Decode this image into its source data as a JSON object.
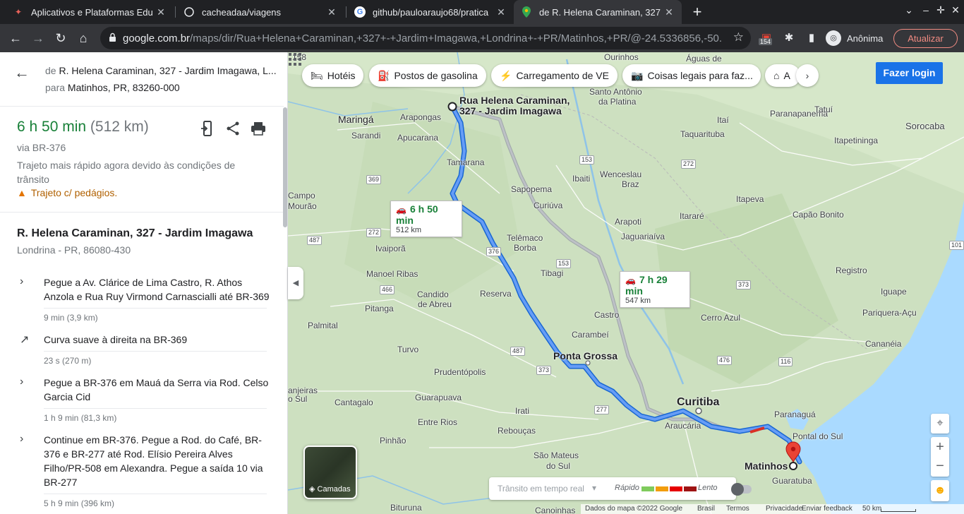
{
  "browser": {
    "tabs": [
      {
        "title": "Aplicativos e Plataformas Edu",
        "icon": "app-tab-icon"
      },
      {
        "title": "cacheadaa/viagens",
        "icon": "github-icon"
      },
      {
        "title": "github/pauloaraujo68/pratica",
        "icon": "google-icon"
      },
      {
        "title": "de R. Helena Caraminan, 327",
        "icon": "maps-icon"
      }
    ],
    "url_host": "google.com.br",
    "url_path": "/maps/dir/Rua+Helena+Caraminan,+327+-+Jardim+Imagawa,+Londrina+-+PR/Matinhos,+PR/@-24.5336856,-50....",
    "extension_badge": "154",
    "profile_label": "Anônima",
    "update_label": "Atualizar"
  },
  "directions": {
    "from_label": "de",
    "from": "R. Helena Caraminan, 327 - Jardim Imagawa, L...",
    "to_label": "para",
    "to": "Matinhos, PR, 83260-000",
    "duration": "6 h 50 min",
    "distance": "(512 km)",
    "via": "via BR-376",
    "note": "Trajeto mais rápido agora devido às condições de trânsito",
    "warning": "Trajeto c/ pedágios.",
    "origin_title": "R. Helena Caraminan, 327 - Jardim Imagawa",
    "origin_subtitle": "Londrina - PR, 86080-430",
    "steps": [
      {
        "text": "Pegue a Av. Clárice de Lima Castro, R. Athos Anzola e Rua Ruy Virmond Carnascialli até BR-369",
        "meta": "9 min (3,9 km)",
        "icon": "chevron-right-icon"
      },
      {
        "text": "Curva suave à direita na BR-369",
        "meta": "23 s (270 m)",
        "icon": "slight-right-arrow-icon"
      },
      {
        "text": "Pegue a BR-376 em Mauá da Serra via Rod. Celso Garcia Cid",
        "meta": "1 h 9 min (81,3 km)",
        "icon": "chevron-right-icon"
      },
      {
        "text": "Continue em BR-376. Pegue a Rod. do Café, BR-376 e BR-277 até Rod. Elísio Pereira Alves Filho/PR-508 em Alexandra. Pegue a saída 10 via BR-277",
        "meta": "5 h 9 min (396 km)",
        "icon": "chevron-right-icon"
      }
    ]
  },
  "map": {
    "chips": [
      "Hotéis",
      "Postos de gasolina",
      "Carregamento de VE",
      "Coisas legais para faz...",
      "A"
    ],
    "login": "Fazer login",
    "callout_main": {
      "time": "6 h 50 min",
      "dist": "512 km"
    },
    "callout_alt": {
      "time": "7 h 29 min",
      "dist": "547 km"
    },
    "origin_pin_label": "Rua Helena Caraminan, 327 - Jardim Imagawa",
    "dest_pin_label": "Matinhos",
    "layers_label": "Camadas",
    "traffic_select": "Trânsito em tempo real",
    "traffic_fast": "Rápido",
    "traffic_slow": "Lento",
    "traffic_colors": [
      "#7fcb5c",
      "#f29d0c",
      "#e60000",
      "#9e1313"
    ],
    "attribution": [
      "Dados do mapa ©2022 Google",
      "Brasil",
      "Termos",
      "Privacidade",
      "Enviar feedback",
      "50 km"
    ],
    "places": [
      "158",
      "Ourinhos",
      "Águas de",
      "Santo Antônio",
      "da Platina",
      "Maringá",
      "Arapongas",
      "Sarandi",
      "Apucarana",
      "Tamarana",
      "Campo",
      "Mourão",
      "Ivaiporã",
      "Manoel Ribas",
      "Candido",
      "de Abreu",
      "Pitanga",
      "Palmital",
      "Turvo",
      "Prudentópolis",
      "Guarapuava",
      "Cantagalo",
      "Entre Rios",
      "Pinhão",
      "Irati",
      "Rebouças",
      "São Mateus",
      "do Sul",
      "Bituruna",
      "Canoinhas",
      "anjeiras",
      "o Sul",
      "Sapopema",
      "Curiúva",
      "Telêmaco",
      "Borba",
      "Tibagi",
      "Reserva",
      "Castro",
      "Carambeí",
      "Ponta Grossa",
      "Curitiba",
      "Araucária",
      "Paranaguá",
      "Pontal do Sul",
      "Guaratuba",
      "Ibaiti",
      "Wenceslau",
      "Braz",
      "Arapoti",
      "Jaguariaíva",
      "Itararé",
      "Cerro Azul",
      "Itaí",
      "Taquarituba",
      "Itapeva",
      "Capão Bonito",
      "Registro",
      "Iguape",
      "Pariquera-Açu",
      "Cananéia",
      "Paranapanema",
      "Tatuí",
      "Itapetininga",
      "Sorocaba"
    ],
    "roads": [
      "369",
      "272",
      "487",
      "466",
      "376",
      "153",
      "487",
      "373",
      "277",
      "476",
      "116",
      "373",
      "101",
      "272",
      "153"
    ]
  }
}
